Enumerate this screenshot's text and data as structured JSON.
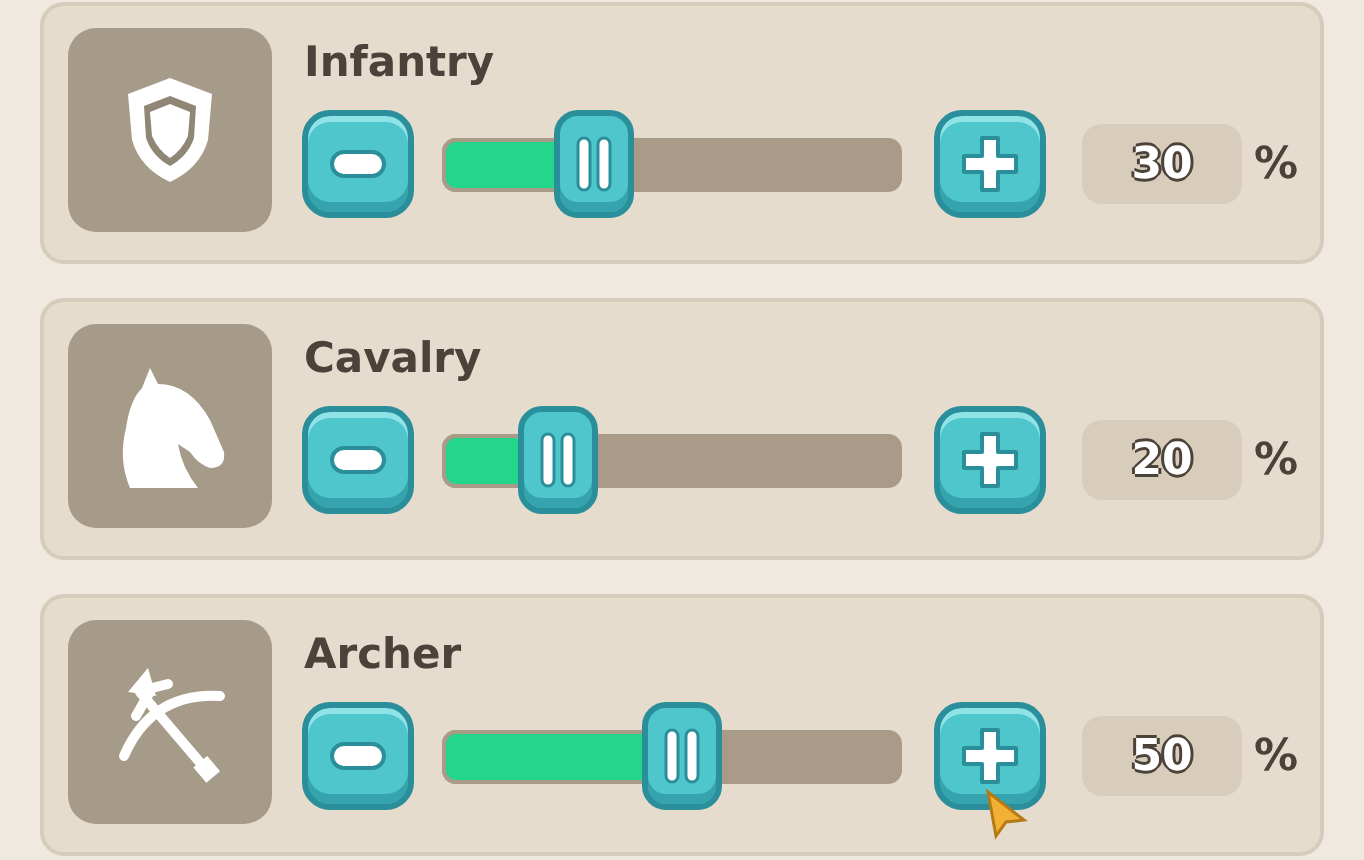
{
  "units": [
    {
      "name": "Infantry",
      "level": 0.33,
      "value": "30",
      "unit": "%"
    },
    {
      "name": "Cavalry",
      "level": 0.25,
      "value": "20",
      "unit": "%"
    },
    {
      "name": "Archer",
      "level": 0.52,
      "value": "50",
      "unit": "%"
    }
  ]
}
